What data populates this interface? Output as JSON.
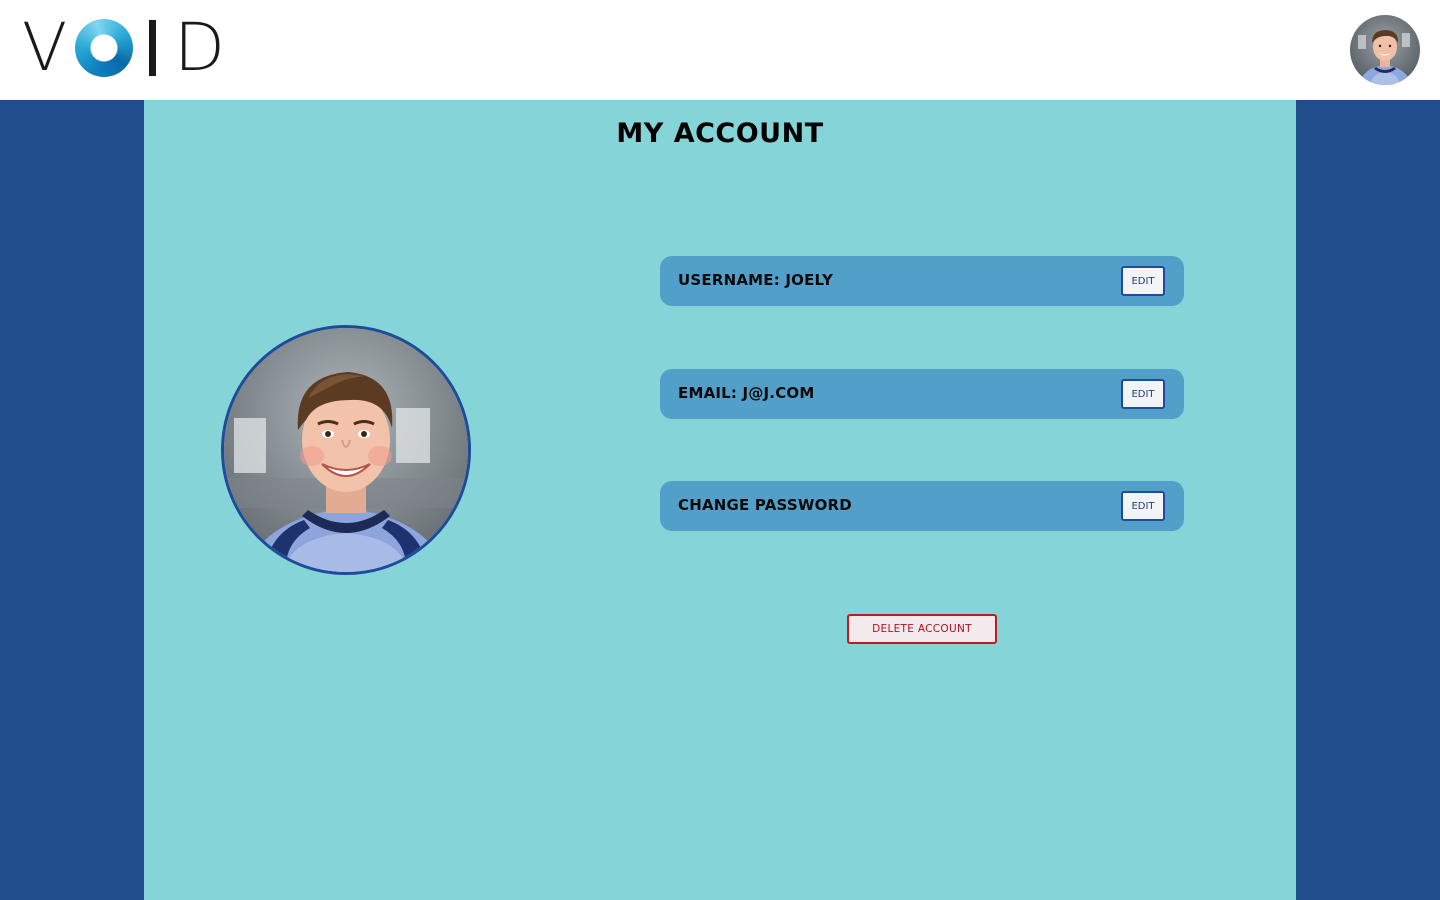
{
  "app": {
    "logo_text": [
      "V",
      "I",
      "D"
    ],
    "logo_ring_colors": [
      "#0e7fbf",
      "#2aa9d8",
      "#7fd6ef"
    ]
  },
  "header": {
    "avatar_icon": "user-avatar-icon"
  },
  "page": {
    "title": "My Account"
  },
  "account": {
    "rows": [
      {
        "label": "Username: Joely",
        "button": "Edit"
      },
      {
        "label": "Email: j@j.com",
        "button": "Edit"
      },
      {
        "label": "Change Password",
        "button": "Edit"
      }
    ],
    "delete_label": "Delete Account"
  },
  "colors": {
    "side_background": "#214d8c",
    "main_background": "#84d4d8",
    "row_background": "#529fc9",
    "button_border": "#1f4b9a",
    "danger": "#c2181f"
  }
}
